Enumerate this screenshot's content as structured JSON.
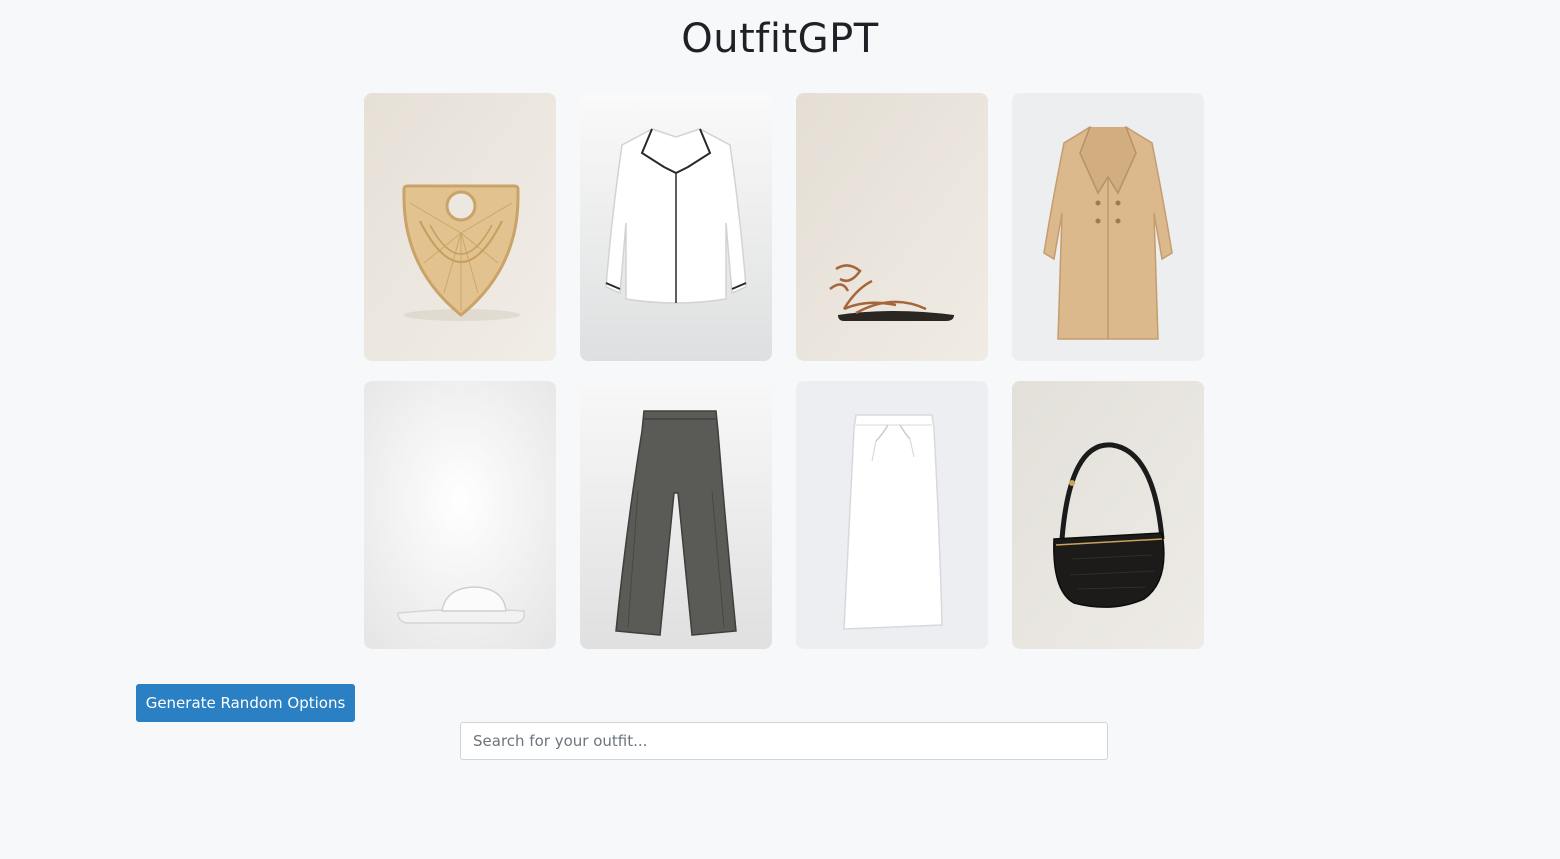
{
  "app": {
    "title": "OutfitGPT"
  },
  "products": [
    {
      "item": "rattan-half-moon-bag-icon",
      "background": "#ece7e0"
    },
    {
      "item": "white-piped-shirt-icon",
      "background": "#f4f4f4"
    },
    {
      "item": "tie-up-flat-sandals-icon",
      "background": "#ebe6df"
    },
    {
      "item": "camel-double-breasted-coat-icon",
      "background": "#eceef0"
    },
    {
      "item": "white-slide-sandal-icon",
      "background": "#f3f3f3"
    },
    {
      "item": "grey-flared-trousers-icon",
      "background": "#f3f3f3"
    },
    {
      "item": "white-midi-skirt-icon",
      "background": "#eceef1"
    },
    {
      "item": "black-croc-shoulder-bag-icon",
      "background": "#e9e6e1"
    }
  ],
  "actions": {
    "generate_label": "Generate Random Options"
  },
  "search": {
    "placeholder": "Search for your outfit...",
    "value": ""
  },
  "colors": {
    "page_background": "#f7f8fa",
    "primary_button": "#2b80c3"
  }
}
